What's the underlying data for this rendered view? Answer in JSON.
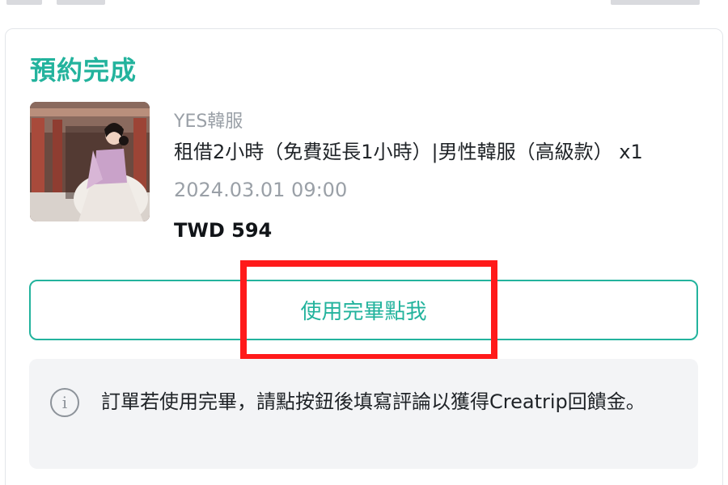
{
  "order": {
    "status": "預約完成",
    "vendor": "YES韓服",
    "item_title": "租借2小時（免費延長1小時）|男性韓服（高級款） x1",
    "datetime": "2024.03.01 09:00",
    "price": "TWD 594"
  },
  "actions": {
    "complete_button_label": "使用完畢點我"
  },
  "notice": {
    "text": "訂單若使用完畢，請點按鈕後填寫評論以獲得Creatrip回饋金。",
    "icon": "info-icon"
  },
  "colors": {
    "accent": "#23b39d",
    "highlight": "#ff1a1a",
    "muted_text": "#9aa0a7",
    "notice_bg": "#f3f4f6"
  }
}
